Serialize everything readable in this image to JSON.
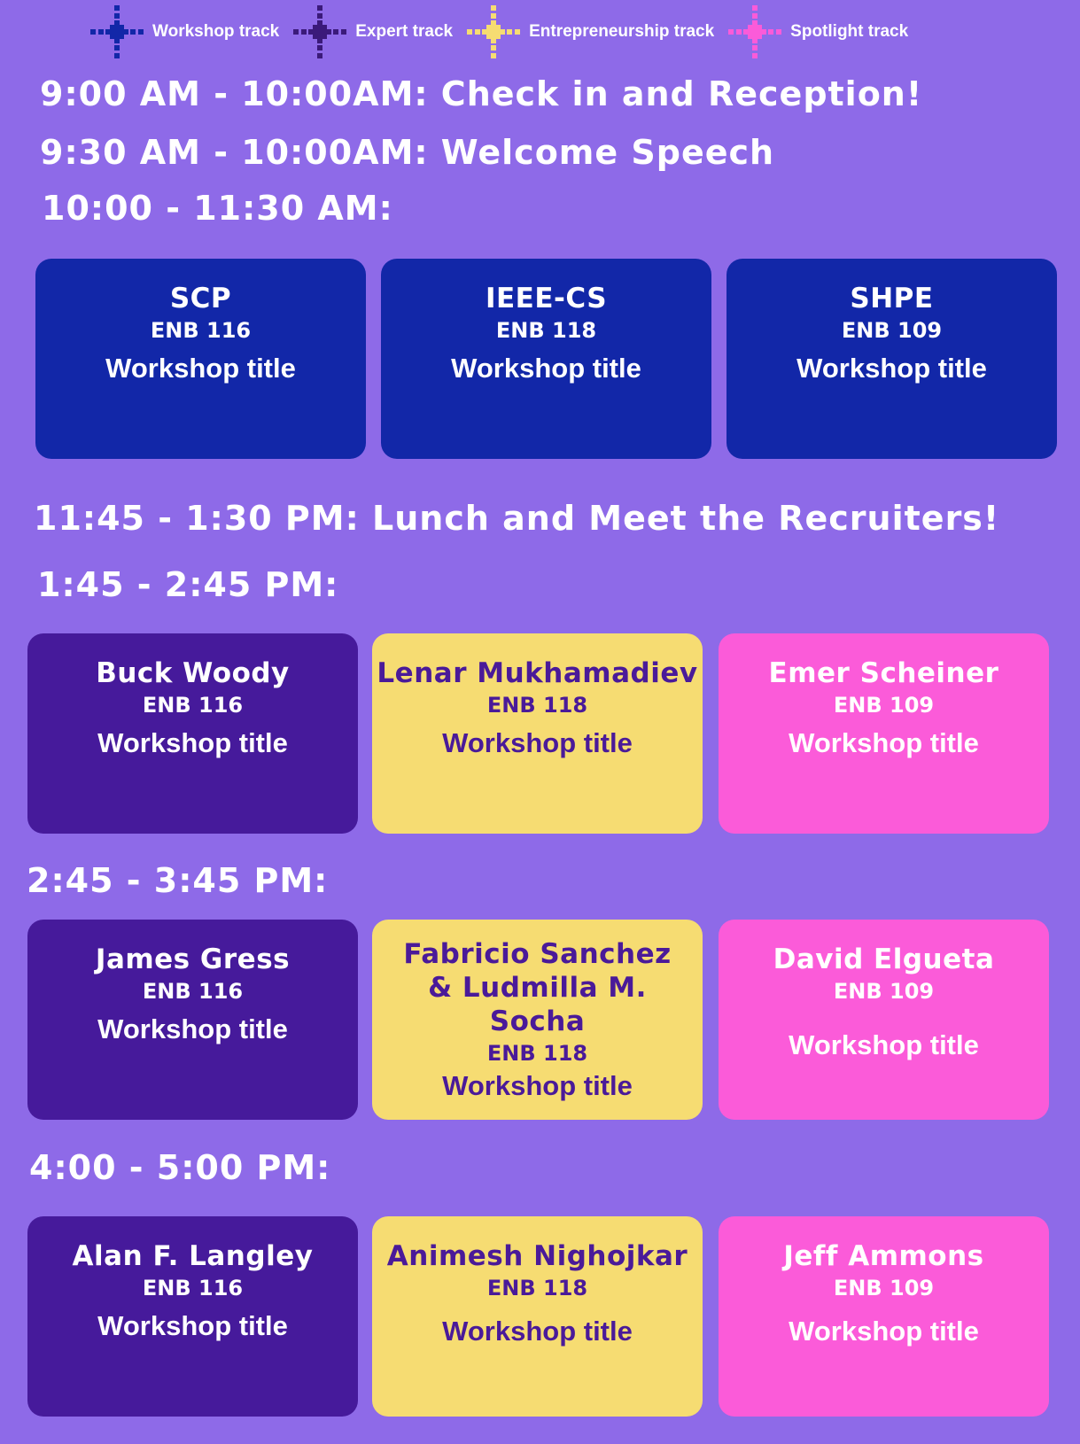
{
  "legend": [
    {
      "label": "Workshop track",
      "color": "#1227a8"
    },
    {
      "label": "Expert track",
      "color": "#3b1a7a"
    },
    {
      "label": "Entrepreneurship track",
      "color": "#f6dc72"
    },
    {
      "label": "Spotlight track",
      "color": "#fb5bd9"
    }
  ],
  "headings": {
    "checkin": "9:00 AM - 10:00AM: Check in and Reception!",
    "welcome": "9:30 AM - 10:00AM: Welcome Speech",
    "slot1": "10:00 - 11:30 AM:",
    "lunch": "11:45 - 1:30 PM: Lunch and Meet the Recruiters!",
    "slot2": "1:45 - 2:45 PM:",
    "slot3": "2:45 - 3:45 PM:",
    "slot4": "4:00 - 5:00 PM:"
  },
  "slot1": [
    {
      "name": "SCP",
      "room": "ENB 116",
      "title": "Workshop title"
    },
    {
      "name": "IEEE-CS",
      "room": "ENB 118",
      "title": "Workshop title"
    },
    {
      "name": "SHPE",
      "room": "ENB 109",
      "title": "Workshop title"
    }
  ],
  "slot2": [
    {
      "name": "Buck Woody",
      "room": "ENB 116",
      "title": "Workshop title"
    },
    {
      "name": "Lenar Mukhamadiev",
      "room": "ENB 118",
      "title": "Workshop title"
    },
    {
      "name": "Emer Scheiner",
      "room": "ENB 109",
      "title": "Workshop title"
    }
  ],
  "slot3": [
    {
      "name": "James Gress",
      "room": "ENB 116",
      "title": "Workshop title"
    },
    {
      "name": "Fabricio Sanchez & Ludmilla M. Socha",
      "room": "ENB 118",
      "title": "Workshop title"
    },
    {
      "name": "David Elgueta",
      "room": "ENB 109",
      "title": "Workshop title"
    }
  ],
  "slot4": [
    {
      "name": "Alan F. Langley",
      "room": "ENB 116",
      "title": "Workshop title"
    },
    {
      "name": "Animesh Nighojkar",
      "room": "ENB 118",
      "title": "Workshop title"
    },
    {
      "name": "Jeff Ammons",
      "room": "ENB 109",
      "title": "Workshop title"
    }
  ]
}
